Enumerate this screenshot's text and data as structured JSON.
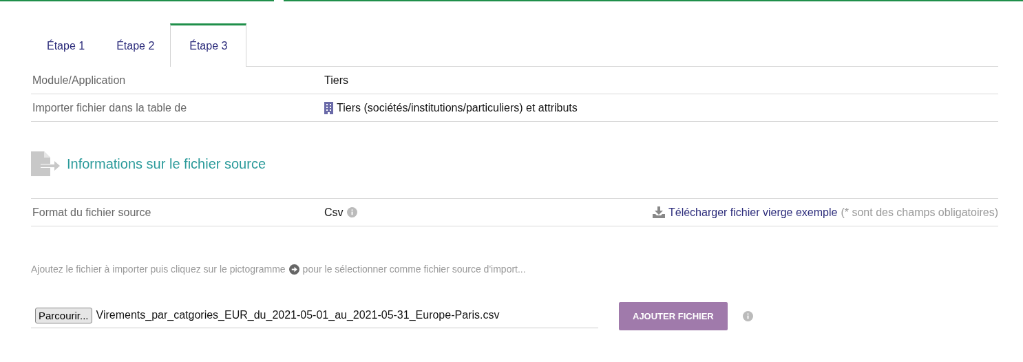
{
  "tabs": [
    {
      "label": "Étape 1",
      "selected": false
    },
    {
      "label": "Étape 2",
      "selected": false
    },
    {
      "label": "Étape 3",
      "selected": true
    }
  ],
  "info_rows": [
    {
      "label": "Module/Application",
      "value": "Tiers",
      "has_icon": false
    },
    {
      "label": "Importer fichier dans la table de",
      "value": "Tiers (sociétés/institutions/particuliers) et attributs",
      "has_icon": true
    }
  ],
  "section": {
    "title": "Informations sur le fichier source"
  },
  "format_row": {
    "label": "Format du fichier source",
    "value": "Csv",
    "download_link": "Télécharger fichier vierge exemple",
    "note": "(* sont des champs obligatoires)"
  },
  "hint": {
    "before": "Ajoutez le fichier à importer puis cliquez sur le pictogramme",
    "after": "pour le sélectionner comme fichier source d'import..."
  },
  "file_input": {
    "browse_label": "Parcourir...",
    "file_name": "Virements_par_catgories_EUR_du_2021-05-01_au_2021-05-31_Europe-Paris.csv"
  },
  "add_button": "AJOUTER FICHIER"
}
